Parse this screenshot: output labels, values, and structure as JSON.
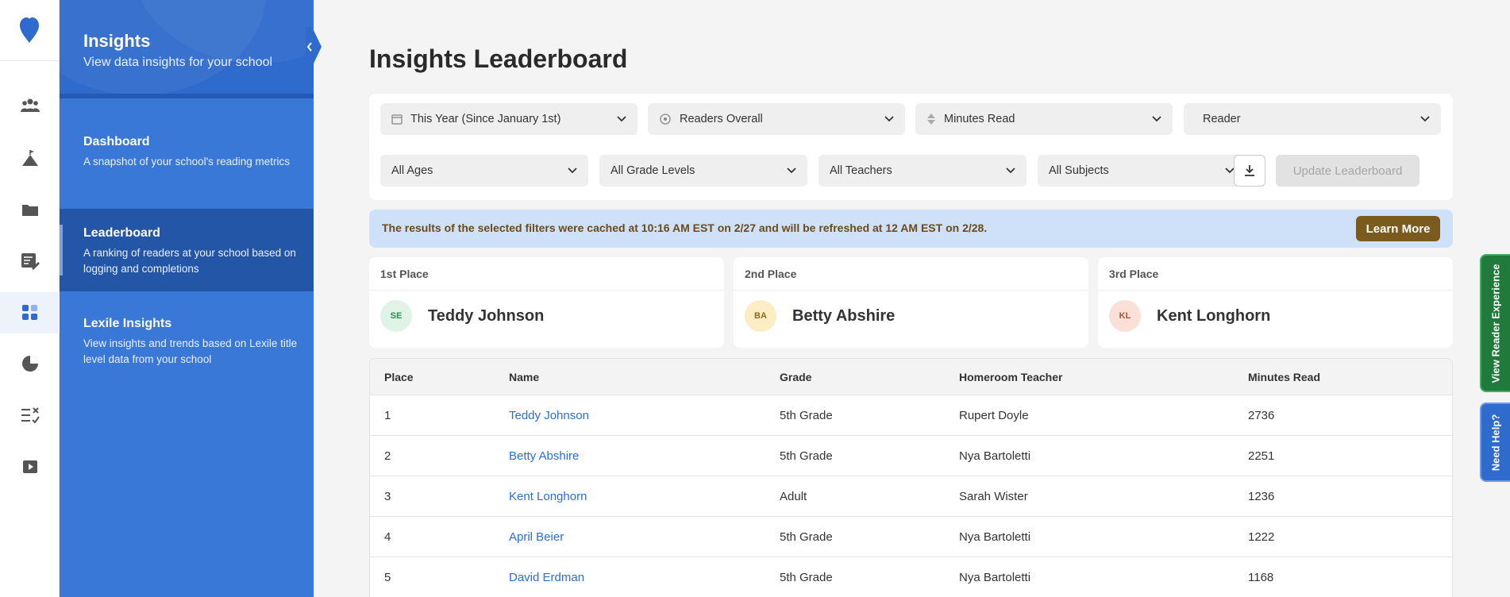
{
  "sidebar": {
    "title": "Insights",
    "subtitle": "View data insights for your school",
    "items": [
      {
        "title": "Dashboard",
        "desc": "A snapshot of your school's reading metrics"
      },
      {
        "title": "Leaderboard",
        "desc": "A ranking of readers at your school based on logging and completions"
      },
      {
        "title": "Lexile Insights",
        "desc": "View insights and trends based on Lexile title level data from your school"
      }
    ]
  },
  "rail": {
    "icons": [
      "logo-heart-icon",
      "students-icon",
      "mountain-flag-icon",
      "folder-icon",
      "reading-log-icon",
      "insights-icon",
      "pie-chart-icon",
      "checklist-icon",
      "video-icon"
    ],
    "active": "insights-icon"
  },
  "page": {
    "title": "Insights Leaderboard"
  },
  "filters": {
    "time_range": "This Year (Since January 1st)",
    "reader_scope": "Readers Overall",
    "metric": "Minutes Read",
    "group_by": "Reader",
    "ages": "All Ages",
    "grade_levels": "All Grade Levels",
    "teachers": "All Teachers",
    "subjects": "All Subjects",
    "update_label": "Update Leaderboard"
  },
  "banner": {
    "message": "The results of the selected filters were cached at 10:16 AM EST on 2/27 and will be refreshed at 12 AM EST on 2/28.",
    "learn_more": "Learn More"
  },
  "podium": [
    {
      "label": "1st Place",
      "initials": "SE",
      "name": "Teddy Johnson",
      "bg": "#dff4e6",
      "fg": "#2f8a4f"
    },
    {
      "label": "2nd Place",
      "initials": "BA",
      "name": "Betty Abshire",
      "bg": "#fdecc4",
      "fg": "#8a6a1c"
    },
    {
      "label": "3rd Place",
      "initials": "KL",
      "name": "Kent Longhorn",
      "bg": "#fbe0d8",
      "fg": "#b0503a"
    }
  ],
  "table": {
    "columns": [
      "Place",
      "Name",
      "Grade",
      "Homeroom Teacher",
      "Minutes Read"
    ],
    "rows": [
      {
        "place": "1",
        "name": "Teddy Johnson",
        "grade": "5th Grade",
        "teacher": "Rupert Doyle",
        "minutes": "2736"
      },
      {
        "place": "2",
        "name": "Betty Abshire",
        "grade": "5th Grade",
        "teacher": "Nya Bartoletti",
        "minutes": "2251"
      },
      {
        "place": "3",
        "name": "Kent Longhorn",
        "grade": "Adult",
        "teacher": "Sarah Wister",
        "minutes": "1236"
      },
      {
        "place": "4",
        "name": "April Beier",
        "grade": "5th Grade",
        "teacher": "Nya Bartoletti",
        "minutes": "1222"
      },
      {
        "place": "5",
        "name": "David Erdman",
        "grade": "5th Grade",
        "teacher": "Nya Bartoletti",
        "minutes": "1168"
      }
    ]
  },
  "side_tabs": {
    "reader_experience": "View Reader Experience",
    "help": "Need Help?"
  },
  "colors": {
    "sidebar": "#3a78d8",
    "sidebar_active": "#2456a8",
    "link": "#2a6fd3",
    "learn_more": "#7b5a1e",
    "banner": "#cfe1f9"
  }
}
